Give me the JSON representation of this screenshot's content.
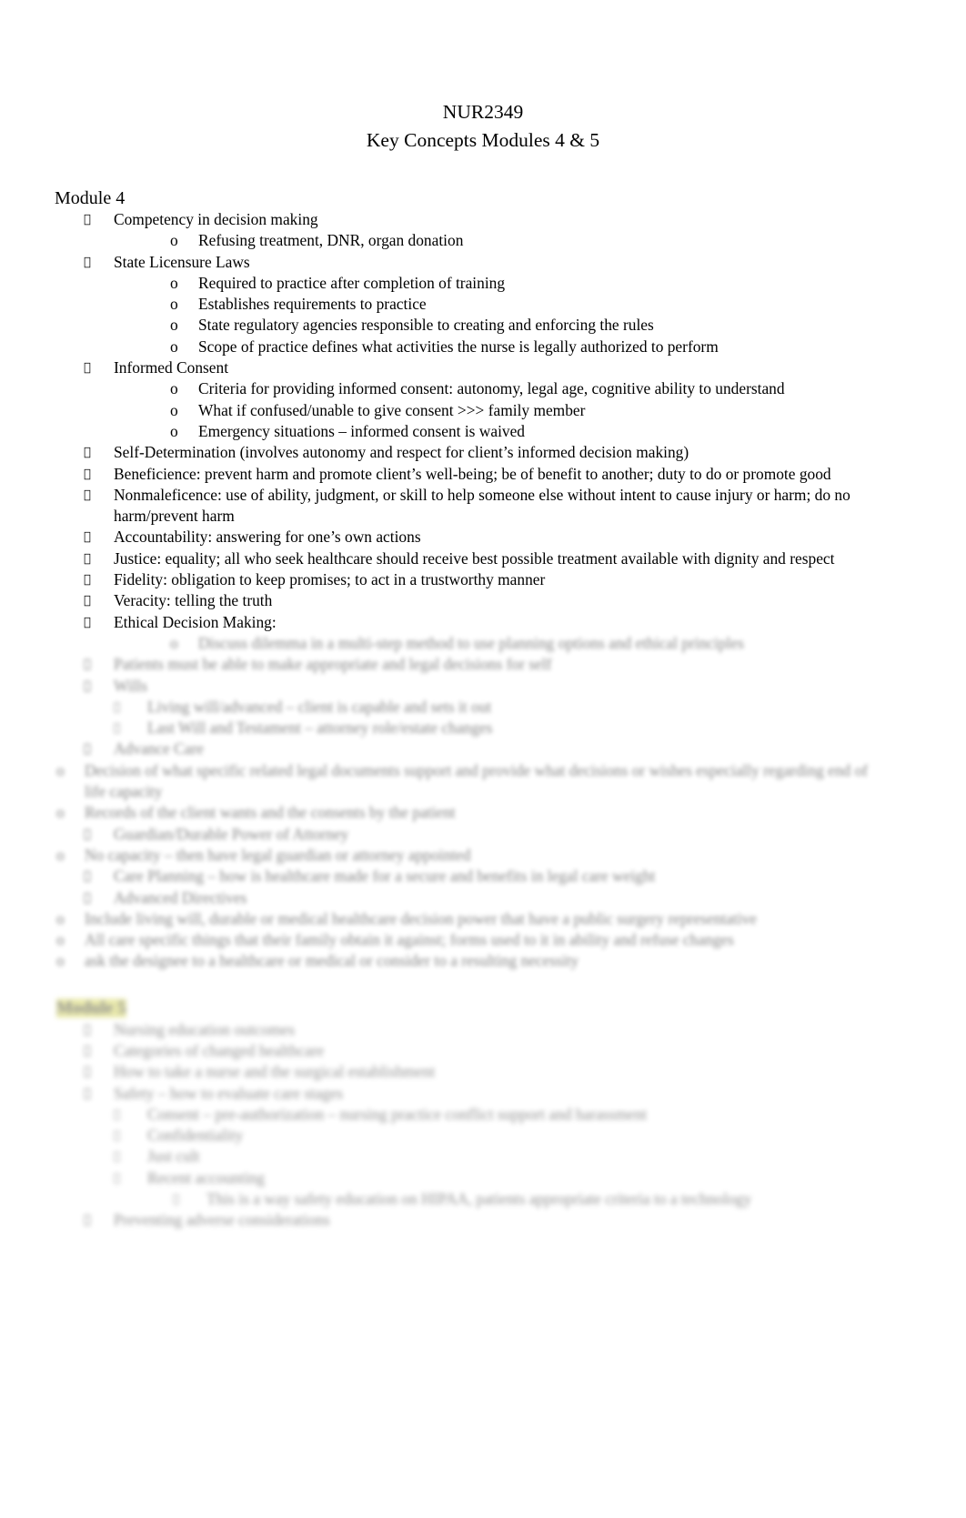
{
  "document": {
    "title_lines": [
      "NUR2349",
      "Key Concepts Modules 4 & 5"
    ],
    "module4_heading": "Module 4",
    "module5_heading": "Module 5",
    "bullet_marker": "",
    "sub_marker": "o",
    "dash_marker": ""
  },
  "module4": {
    "items": [
      {
        "text": "Competency in decision making",
        "subs": [
          "Refusing treatment, DNR, organ donation"
        ]
      },
      {
        "text": "State Licensure Laws",
        "subs": [
          "Required to practice after completion of training",
          "Establishes requirements to practice",
          "State regulatory agencies responsible to creating and enforcing the rules",
          "Scope of practice defines what activities the nurse is legally authorized to perform"
        ]
      },
      {
        "text": "Informed Consent",
        "subs": [
          "Criteria for providing informed consent: autonomy, legal age, cognitive ability to understand",
          "What if confused/unable to give consent >>> family member",
          "Emergency situations – informed consent is waived"
        ]
      },
      {
        "text": "Self-Determination (involves autonomy and respect for client’s informed decision making)",
        "subs": []
      },
      {
        "text": "Beneficience: prevent harm and promote client’s well-being; be of benefit to another; duty to do or promote good",
        "subs": []
      },
      {
        "text": "Nonmaleficence: use of ability, judgment, or skill to help someone else without intent to cause injury or harm; do no harm/prevent harm",
        "subs": []
      },
      {
        "text": "Accountability: answering for one’s own actions",
        "subs": []
      },
      {
        "text": "Justice: equality; all who seek healthcare should receive best possible treatment available with dignity and respect",
        "subs": []
      },
      {
        "text": "Fidelity: obligation to keep promises; to act in a trustworthy manner",
        "subs": []
      },
      {
        "text": "Veracity: telling the truth",
        "subs": []
      },
      {
        "text": "Ethical Decision Making:",
        "subs": [
          "Discuss dilemma in a multi-step method to use planning options and ethical principles"
        ]
      }
    ],
    "blurred_items": [
      {
        "level": 1,
        "text": "Patients must be able to make appropriate and legal decisions for self"
      },
      {
        "level": 1,
        "text": "Wills"
      },
      {
        "level": 3,
        "text": "Living will/advanced – client is capable and sets it out"
      },
      {
        "level": 3,
        "text": "Last Will and Testament – attorney role/estate changes"
      },
      {
        "level": 1,
        "text": "Advance Care"
      },
      {
        "level": 2,
        "text": "Decision of what specific related legal documents support and provide what decisions or wishes especially regarding end of life capacity"
      },
      {
        "level": 2,
        "text": "Records of the client wants and the consents by the patient"
      },
      {
        "level": 1,
        "text": "Guardian/Durable Power of Attorney"
      },
      {
        "level": 2,
        "text": "No capacity – then have legal guardian or attorney appointed"
      },
      {
        "level": 1,
        "text": "Care Planning – how is healthcare made for a secure and benefits in legal care weight"
      },
      {
        "level": 1,
        "text": "Advanced Directives"
      },
      {
        "level": 2,
        "text": "Include living will, durable or medical healthcare decision power that have a public surgery representative"
      },
      {
        "level": 2,
        "text": "All care specific things that their family obtain it against; forms used to it in ability and refuse changes"
      },
      {
        "level": 2,
        "text": "ask the designee to a healthcare or medical or consider to a resulting necessity"
      }
    ]
  },
  "module5": {
    "blurred_items": [
      {
        "level": 1,
        "text": "Nursing education outcomes"
      },
      {
        "level": 1,
        "text": "Categories of changed healthcare"
      },
      {
        "level": 1,
        "text": "How to take a nurse and the surgical establishment"
      },
      {
        "level": 1,
        "text": "Safety – how to evaluate care stages"
      },
      {
        "level": 3,
        "text": "Consent – pre-authorization – nursing practice conflict support and harassment"
      },
      {
        "level": 3,
        "text": "Confidentiality"
      },
      {
        "level": 3,
        "text": "Just cult"
      },
      {
        "level": 3,
        "text": "Recent accounting"
      },
      {
        "level": 4,
        "text": "This is a way safety education on HIPAA, patients appropriate criteria to a technology"
      },
      {
        "level": 1,
        "text": "Preventing adverse considerations"
      }
    ]
  }
}
